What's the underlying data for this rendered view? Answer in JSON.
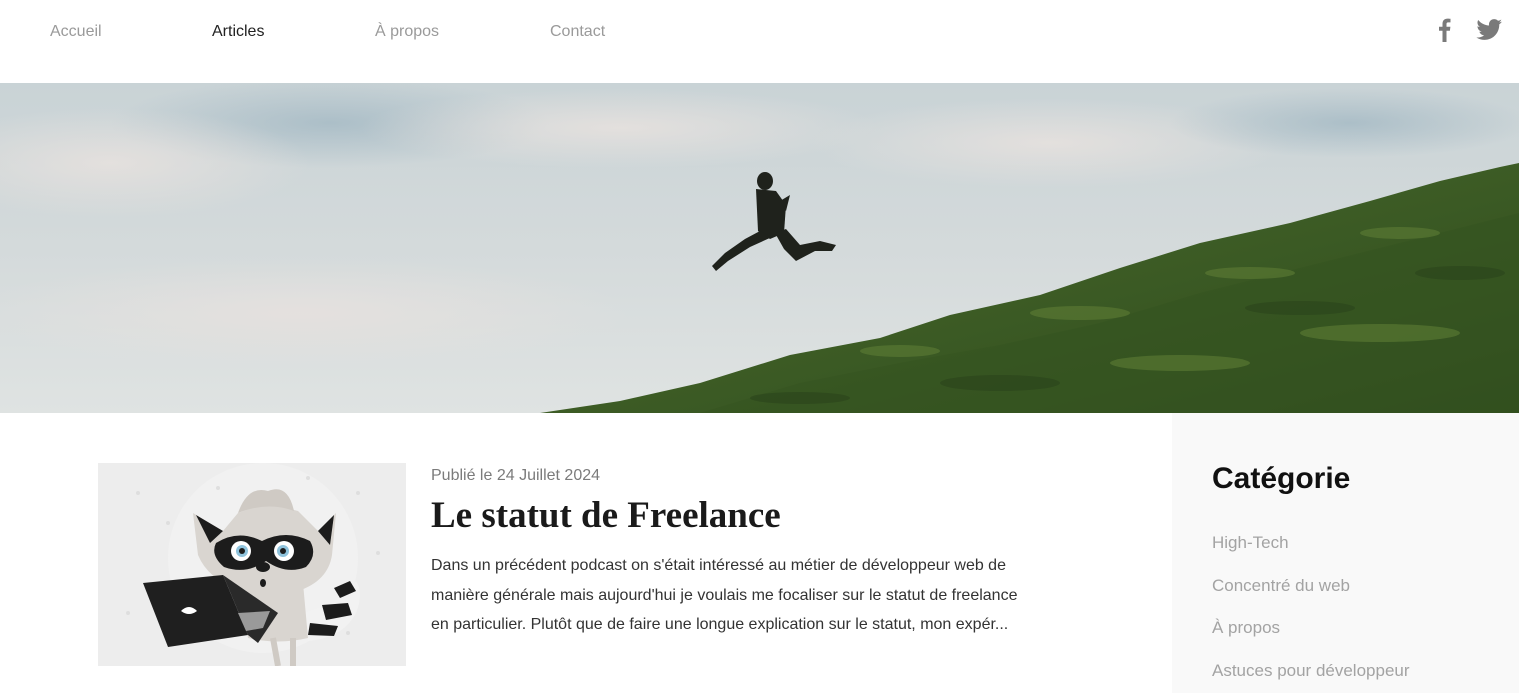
{
  "nav": {
    "items": [
      {
        "label": "Accueil",
        "active": false
      },
      {
        "label": "Articles",
        "active": true
      },
      {
        "label": "À propos",
        "active": false
      },
      {
        "label": "Contact",
        "active": false
      }
    ],
    "social": [
      {
        "icon": "facebook-icon"
      },
      {
        "icon": "twitter-icon"
      }
    ]
  },
  "hero": {
    "image": "runner-jumping-on-grassy-hill"
  },
  "article": {
    "date": "Publié le 24 Juillet 2024",
    "title": "Le statut de Freelance",
    "excerpt": "Dans un précédent podcast on s'était intéressé au métier de développeur web de manière générale mais aujourd'hui je voulais me focaliser sur le statut de freelance en particulier. Plutôt que de faire une longue explication sur le statut, mon expér...",
    "thumbnail": "raccoon-with-laptop-illustration"
  },
  "sidebar": {
    "title": "Catégorie",
    "categories": [
      {
        "label": "High-Tech"
      },
      {
        "label": "Concentré du web"
      },
      {
        "label": "À propos"
      },
      {
        "label": "Astuces pour développeur"
      }
    ]
  },
  "colors": {
    "nav_inactive": "#9a9a9a",
    "nav_active": "#222222",
    "sidebar_bg": "#f9f9f9",
    "category_text": "#a3a3a3"
  }
}
